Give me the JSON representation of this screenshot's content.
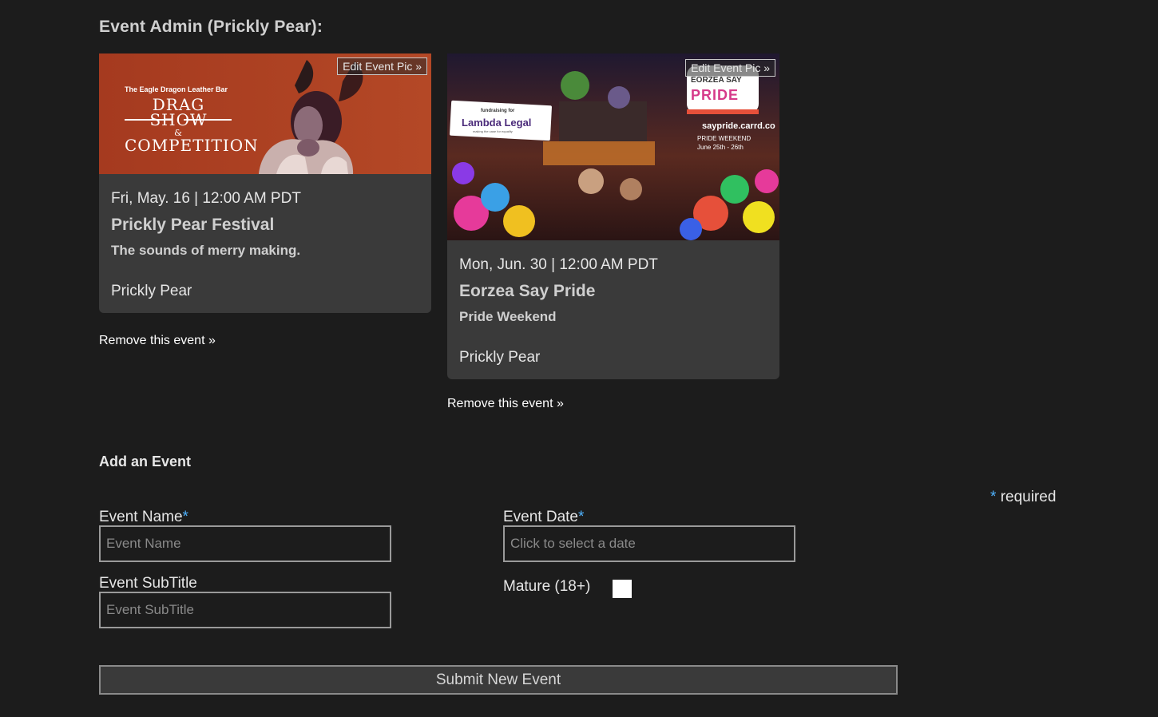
{
  "page_title": "Event Admin (Prickly Pear):",
  "events": [
    {
      "edit_pic_label": "Edit Event Pic »",
      "image_text": {
        "small": "The Eagle Dragon Leather Bar",
        "line1": "DRAG SHOW",
        "amp": "&",
        "line2": "COMPETITION"
      },
      "datetime": "Fri, May. 16 | 12:00 AM PDT",
      "title": "Prickly Pear Festival",
      "subtitle": "The sounds of merry making.",
      "venue": "Prickly Pear",
      "remove_label": "Remove this event »"
    },
    {
      "edit_pic_label": "Edit Event Pic »",
      "image_text": {
        "fundraising": "fundraising for",
        "lambda": "Lambda Legal",
        "lambda_tag": "making the case for equality",
        "eorzea": "EORZEA SAY",
        "pride": "PRIDE",
        "url": "saypride.carrd.co",
        "weekend": "PRIDE WEEKEND",
        "dates": "June 25th - 26th"
      },
      "datetime": "Mon, Jun. 30 | 12:00 AM PDT",
      "title": "Eorzea Say Pride",
      "subtitle": "Pride Weekend",
      "venue": "Prickly Pear",
      "remove_label": "Remove this event »"
    }
  ],
  "add_event": {
    "section_title": "Add an Event",
    "required_star": "*",
    "required_text": "required",
    "name_label": "Event Name",
    "name_placeholder": "Event Name",
    "subtitle_label": "Event SubTitle",
    "subtitle_placeholder": "Event SubTitle",
    "date_label": "Event Date",
    "date_placeholder": "Click to select a date",
    "mature_label": "Mature (18+)",
    "submit_label": "Submit New Event"
  },
  "colors": {
    "background": "#1c1c1c",
    "card": "#3a3a3a",
    "required_star": "#4fb3ff"
  }
}
